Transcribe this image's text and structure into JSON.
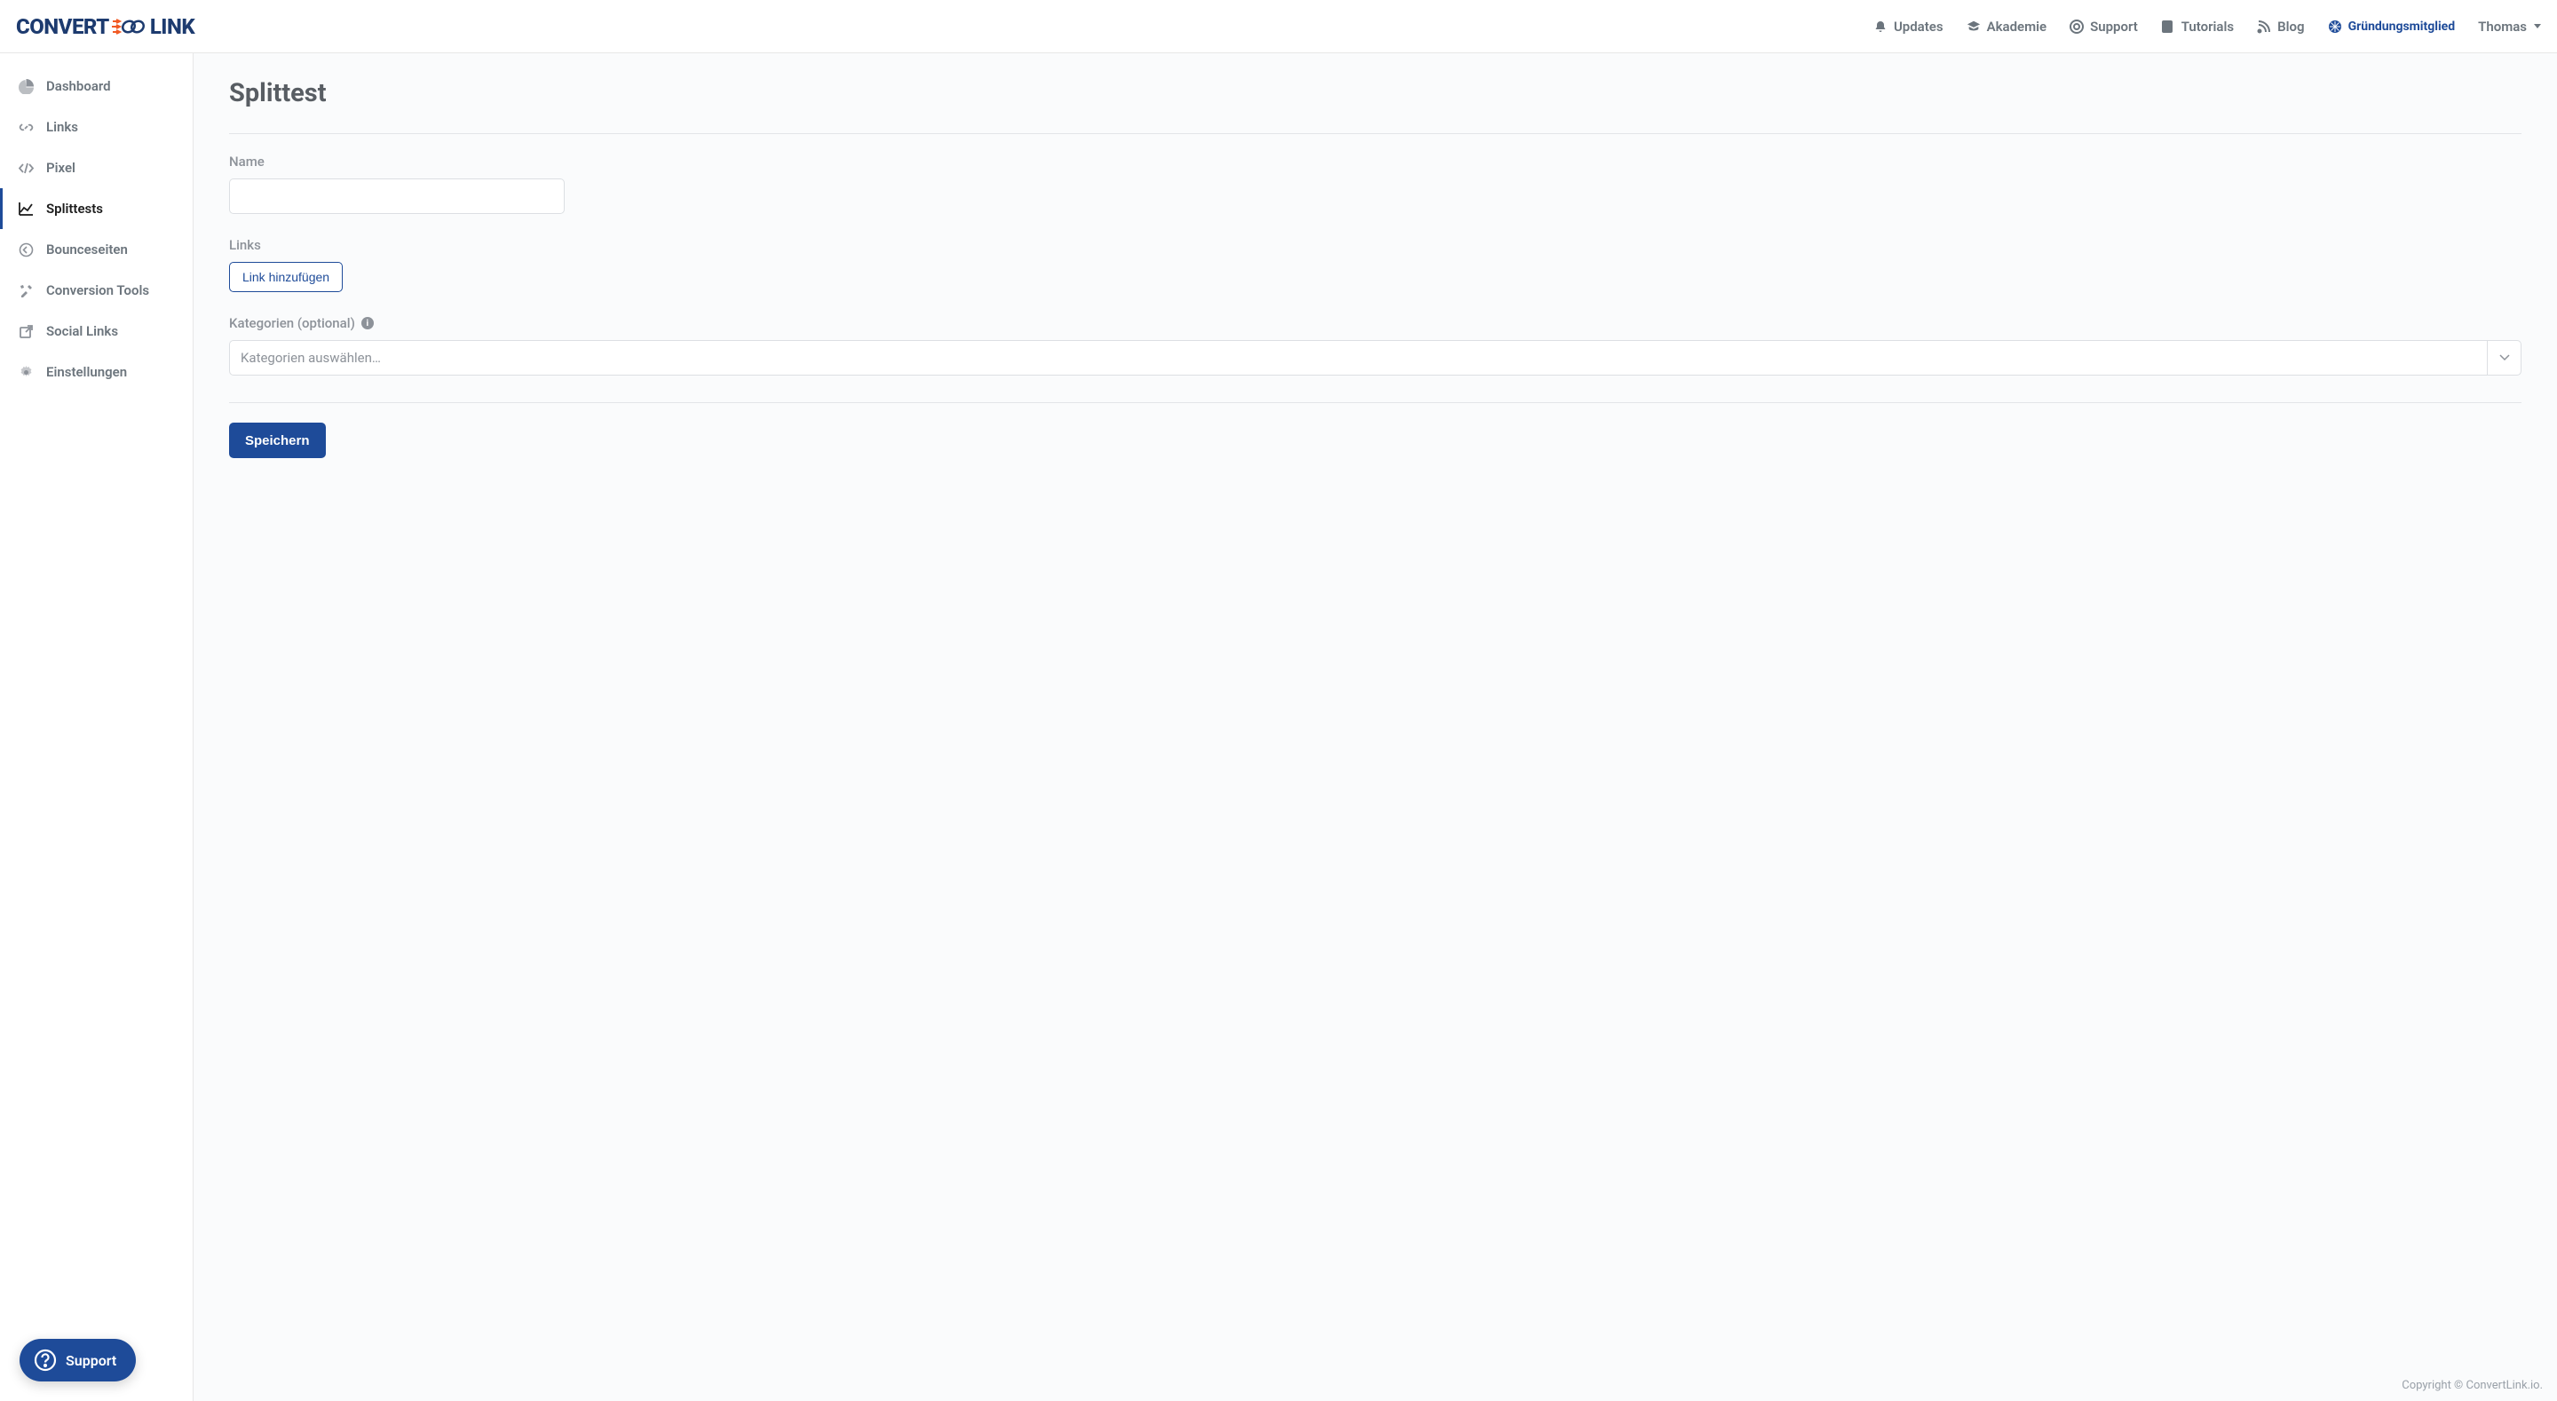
{
  "brand": {
    "part1": "CONVERT",
    "part2": "LINK"
  },
  "nav": {
    "updates": "Updates",
    "akademie": "Akademie",
    "support": "Support",
    "tutorials": "Tutorials",
    "blog": "Blog",
    "founder_badge": "Gründungsmitglied",
    "user": "Thomas"
  },
  "sidebar": {
    "items": [
      {
        "label": "Dashboard"
      },
      {
        "label": "Links"
      },
      {
        "label": "Pixel"
      },
      {
        "label": "Splittests"
      },
      {
        "label": "Bounceseiten"
      },
      {
        "label": "Conversion Tools"
      },
      {
        "label": "Social Links"
      },
      {
        "label": "Einstellungen"
      }
    ]
  },
  "page": {
    "title": "Splittest",
    "name_label": "Name",
    "name_value": "",
    "links_label": "Links",
    "add_link_button": "Link hinzufügen",
    "categories_label": "Kategorien (optional)",
    "categories_placeholder": "Kategorien auswählen…",
    "save_button": "Speichern"
  },
  "fab": {
    "label": "Support"
  },
  "footer": {
    "text": "Copyright © ConvertLink.io."
  }
}
